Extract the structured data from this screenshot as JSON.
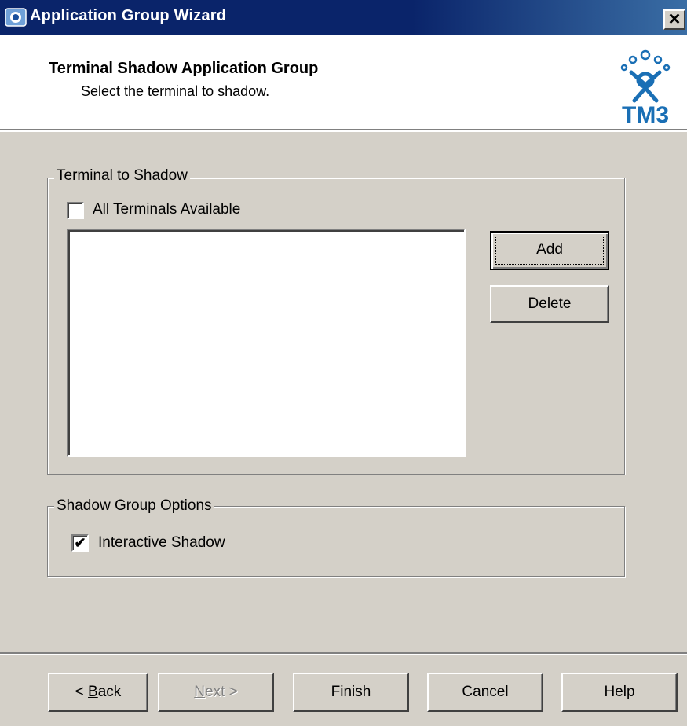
{
  "window": {
    "title": "Application Group Wizard",
    "close_symbol": "✕",
    "icon": "app-icon"
  },
  "header": {
    "title": "Terminal Shadow Application Group",
    "subtitle": "Select the terminal to shadow.",
    "logo_text": "TM3",
    "logo_icon": "tm3-logo-icon"
  },
  "terminal_group": {
    "legend": "Terminal to Shadow",
    "all_terminals_label": "All Terminals Available",
    "all_terminals_checked": false,
    "add_label": "Add",
    "delete_label": "Delete",
    "terminals": []
  },
  "options_group": {
    "legend": "Shadow Group Options",
    "interactive_label": "Interactive Shadow",
    "interactive_checked": true
  },
  "footer": {
    "back": {
      "prefix": "< ",
      "mnemonic": "B",
      "rest": "ack"
    },
    "next": {
      "mnemonic": "N",
      "rest": "ext",
      "suffix": " >"
    },
    "finish_label": "Finish",
    "cancel_label": "Cancel",
    "help_label": "Help"
  },
  "colors": {
    "title_bar": "#0a246a",
    "dialog_face": "#d4d0c8",
    "logo_blue": "#1a6fb5"
  }
}
